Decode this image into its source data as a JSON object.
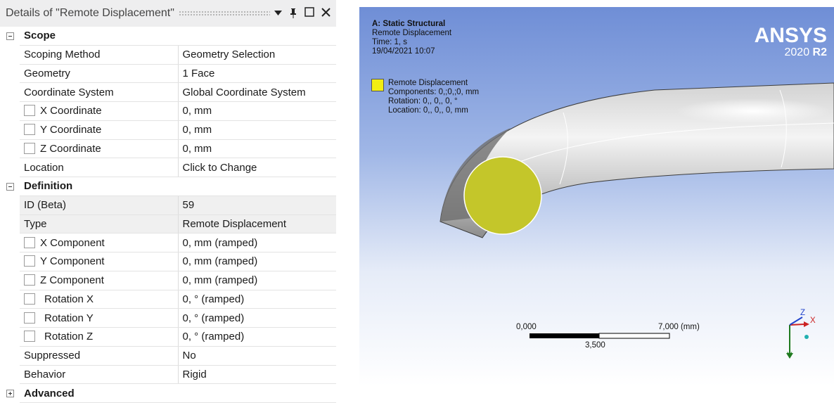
{
  "details": {
    "title": "Details of \"Remote Displacement\"",
    "buttons": {
      "dropdown": "▼",
      "pin": "pin",
      "maximize": "□",
      "close": "✕"
    }
  },
  "groups": {
    "scope": "Scope",
    "definition": "Definition",
    "advanced": "Advanced"
  },
  "rows": {
    "scoping_method": {
      "name": "Scoping Method",
      "value": "Geometry Selection"
    },
    "geometry": {
      "name": "Geometry",
      "value": "1 Face"
    },
    "coordinate_system": {
      "name": "Coordinate System",
      "value": "Global Coordinate System"
    },
    "x_coordinate": {
      "name": "X Coordinate",
      "value": "0, mm"
    },
    "y_coordinate": {
      "name": "Y Coordinate",
      "value": "0, mm"
    },
    "z_coordinate": {
      "name": "Z Coordinate",
      "value": "0, mm"
    },
    "location": {
      "name": "Location",
      "value": "Click to Change"
    },
    "id": {
      "name": "ID (Beta)",
      "value": "59"
    },
    "type": {
      "name": "Type",
      "value": "Remote Displacement"
    },
    "x_component": {
      "name": "X Component",
      "value": "0, mm  (ramped)"
    },
    "y_component": {
      "name": "Y Component",
      "value": "0, mm  (ramped)"
    },
    "z_component": {
      "name": "Z Component",
      "value": "0, mm  (ramped)"
    },
    "rotation_x": {
      "name": "Rotation X",
      "value": "0, °  (ramped)"
    },
    "rotation_y": {
      "name": "Rotation Y",
      "value": "0, °  (ramped)"
    },
    "rotation_z": {
      "name": "Rotation Z",
      "value": "0, °  (ramped)"
    },
    "suppressed": {
      "name": "Suppressed",
      "value": "No"
    },
    "behavior": {
      "name": "Behavior",
      "value": "Rigid"
    }
  },
  "viewport": {
    "analysis": "A: Static Structural",
    "object": "Remote Displacement",
    "time": "Time: 1, s",
    "date": "19/04/2021 10:07",
    "legend": {
      "title": "Remote Displacement",
      "components": "Components: 0,;0,;0, mm",
      "rotation": "Rotation: 0,, 0,, 0, °",
      "location": "Location: 0,, 0,, 0, mm",
      "color": "#f2ee12"
    },
    "logo": {
      "brand": "ANSYS",
      "version": "2020",
      "release": "R2"
    },
    "scale": {
      "min": "0,000",
      "max": "7,000 (mm)",
      "mid": "3,500"
    },
    "triad": {
      "x": "X",
      "y": "Y",
      "z": "Z"
    }
  }
}
